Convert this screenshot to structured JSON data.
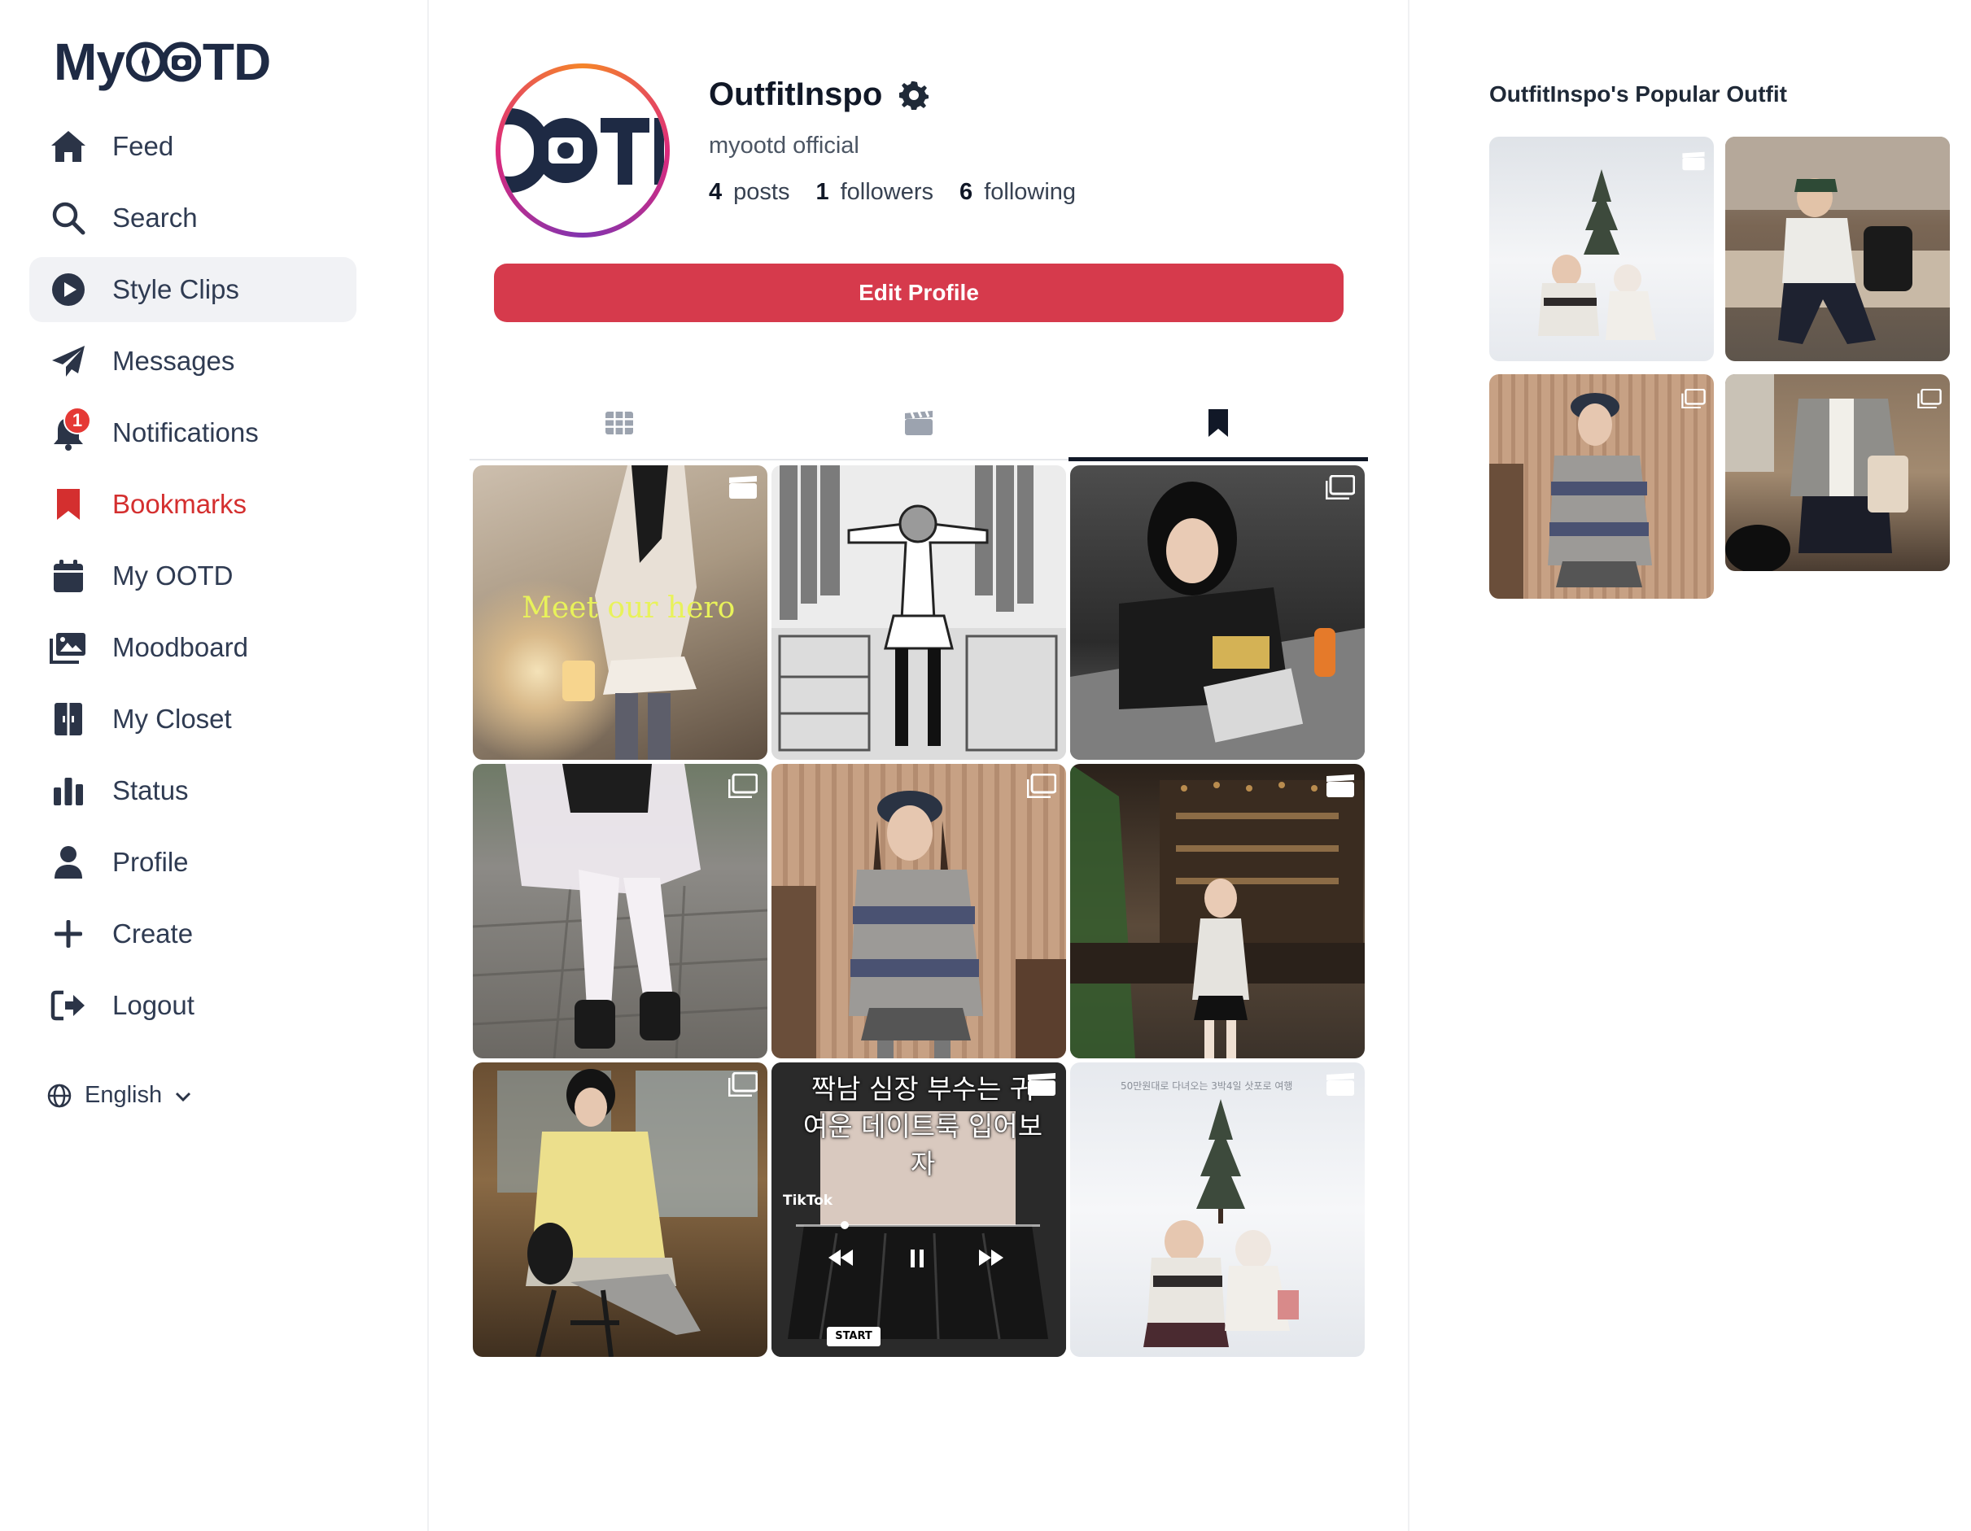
{
  "app": {
    "logo_left": "My",
    "logo_right": "TD"
  },
  "sidebar": {
    "items": [
      {
        "label": "Feed",
        "icon": "home-icon"
      },
      {
        "label": "Search",
        "icon": "search-icon"
      },
      {
        "label": "Style Clips",
        "icon": "play-circle-icon"
      },
      {
        "label": "Messages",
        "icon": "paper-plane-icon"
      },
      {
        "label": "Notifications",
        "icon": "bell-icon",
        "badge": "1"
      },
      {
        "label": "Bookmarks",
        "icon": "bookmark-icon"
      },
      {
        "label": "My OOTD",
        "icon": "calendar-icon"
      },
      {
        "label": "Moodboard",
        "icon": "images-icon"
      },
      {
        "label": "My Closet",
        "icon": "closet-icon"
      },
      {
        "label": "Status",
        "icon": "bar-chart-icon"
      },
      {
        "label": "Profile",
        "icon": "user-icon"
      },
      {
        "label": "Create",
        "icon": "plus-icon"
      },
      {
        "label": "Logout",
        "icon": "logout-icon"
      }
    ],
    "active_item": "Style Clips",
    "language": "English"
  },
  "profile": {
    "avatar_text": "OTI",
    "username": "OutfitInspo",
    "bio": "myootd official",
    "posts_count": "4",
    "posts_label": "posts",
    "followers_count": "1",
    "followers_label": "followers",
    "following_count": "6",
    "following_label": "following",
    "edit_button": "Edit Profile"
  },
  "tabs": [
    {
      "name": "grid",
      "icon": "grid-icon"
    },
    {
      "name": "clips",
      "icon": "clapperboard-icon"
    },
    {
      "name": "saved",
      "icon": "bookmark-icon",
      "active": true
    }
  ],
  "posts": [
    {
      "type": "clip",
      "caption": "Meet our hero",
      "colors": [
        "#d9c6ad",
        "#6b5a48"
      ]
    },
    {
      "type": "photo",
      "caption": "",
      "colors": [
        "#e6e6e6",
        "#9a9a9a"
      ]
    },
    {
      "type": "photo",
      "caption": "",
      "colors": [
        "#5a5a5a",
        "#1f1f1f"
      ]
    },
    {
      "type": "photo",
      "caption": "",
      "colors": [
        "#8e8a84",
        "#4e4b47"
      ]
    },
    {
      "type": "photo",
      "caption": "",
      "colors": [
        "#b89a80",
        "#6d5a4c"
      ]
    },
    {
      "type": "clip",
      "caption": "",
      "colors": [
        "#5b4a3a",
        "#2a211a"
      ]
    },
    {
      "type": "photo",
      "caption": "",
      "colors": [
        "#8a6a45",
        "#4a3622"
      ]
    },
    {
      "type": "clip",
      "caption": "짝남 심장 부수는 귀여운 데이트룩 입어보자",
      "overlay_label": "START",
      "tiktok": "TikTok",
      "colors": [
        "#4a4a4a",
        "#141414"
      ]
    },
    {
      "type": "clip",
      "caption": "50만원대로 다녀오는 3박4일 삿포로 여행",
      "colors": [
        "#f3f4f6",
        "#c9ced6"
      ]
    }
  ],
  "rail": {
    "title": "OutfitInspo's Popular Outfit",
    "items": [
      {
        "type": "clip",
        "colors": [
          "#eef0f3",
          "#bfc5cd"
        ]
      },
      {
        "type": "photo",
        "colors": [
          "#8f7f6a",
          "#3e3a36"
        ]
      },
      {
        "type": "photo",
        "colors": [
          "#b89a80",
          "#6d5a4c"
        ]
      },
      {
        "type": "photo",
        "colors": [
          "#9a7f64",
          "#4a3c31"
        ]
      }
    ]
  },
  "theme": {
    "accent": "#d63a4c",
    "bookmark_red": "#d42f2f",
    "text": "#2f3b52"
  }
}
